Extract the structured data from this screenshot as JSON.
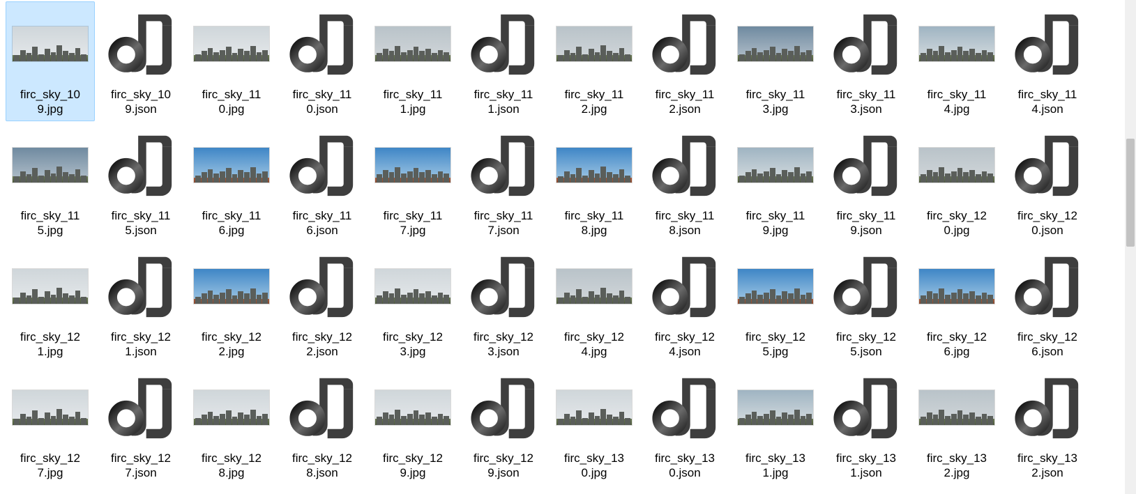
{
  "selected_index": 0,
  "files": [
    {
      "name_line1": "firc_sky_10",
      "name_line2": "9.jpg",
      "type": "jpg",
      "sky": "gray"
    },
    {
      "name_line1": "firc_sky_10",
      "name_line2": "9.json",
      "type": "json"
    },
    {
      "name_line1": "firc_sky_11",
      "name_line2": "0.jpg",
      "type": "jpg",
      "sky": "gray"
    },
    {
      "name_line1": "firc_sky_11",
      "name_line2": "0.json",
      "type": "json"
    },
    {
      "name_line1": "firc_sky_11",
      "name_line2": "1.jpg",
      "type": "jpg",
      "sky": "hazy"
    },
    {
      "name_line1": "firc_sky_11",
      "name_line2": "1.json",
      "type": "json"
    },
    {
      "name_line1": "firc_sky_11",
      "name_line2": "2.jpg",
      "type": "jpg",
      "sky": "hazy"
    },
    {
      "name_line1": "firc_sky_11",
      "name_line2": "2.json",
      "type": "json"
    },
    {
      "name_line1": "firc_sky_11",
      "name_line2": "3.jpg",
      "type": "jpg",
      "sky": "dusk"
    },
    {
      "name_line1": "firc_sky_11",
      "name_line2": "3.json",
      "type": "json"
    },
    {
      "name_line1": "firc_sky_11",
      "name_line2": "4.jpg",
      "type": "jpg",
      "sky": "cloud"
    },
    {
      "name_line1": "firc_sky_11",
      "name_line2": "4.json",
      "type": "json"
    },
    {
      "name_line1": "firc_sky_11",
      "name_line2": "5.jpg",
      "type": "jpg",
      "sky": "dusk"
    },
    {
      "name_line1": "firc_sky_11",
      "name_line2": "5.json",
      "type": "json"
    },
    {
      "name_line1": "firc_sky_11",
      "name_line2": "6.jpg",
      "type": "jpg",
      "sky": "blue"
    },
    {
      "name_line1": "firc_sky_11",
      "name_line2": "6.json",
      "type": "json"
    },
    {
      "name_line1": "firc_sky_11",
      "name_line2": "7.jpg",
      "type": "jpg",
      "sky": "blue"
    },
    {
      "name_line1": "firc_sky_11",
      "name_line2": "7.json",
      "type": "json"
    },
    {
      "name_line1": "firc_sky_11",
      "name_line2": "8.jpg",
      "type": "jpg",
      "sky": "blue"
    },
    {
      "name_line1": "firc_sky_11",
      "name_line2": "8.json",
      "type": "json"
    },
    {
      "name_line1": "firc_sky_11",
      "name_line2": "9.jpg",
      "type": "jpg",
      "sky": "cloud"
    },
    {
      "name_line1": "firc_sky_11",
      "name_line2": "9.json",
      "type": "json"
    },
    {
      "name_line1": "firc_sky_12",
      "name_line2": "0.jpg",
      "type": "jpg",
      "sky": "hazy"
    },
    {
      "name_line1": "firc_sky_12",
      "name_line2": "0.json",
      "type": "json"
    },
    {
      "name_line1": "firc_sky_12",
      "name_line2": "1.jpg",
      "type": "jpg",
      "sky": "gray"
    },
    {
      "name_line1": "firc_sky_12",
      "name_line2": "1.json",
      "type": "json"
    },
    {
      "name_line1": "firc_sky_12",
      "name_line2": "2.jpg",
      "type": "jpg",
      "sky": "blue"
    },
    {
      "name_line1": "firc_sky_12",
      "name_line2": "2.json",
      "type": "json"
    },
    {
      "name_line1": "firc_sky_12",
      "name_line2": "3.jpg",
      "type": "jpg",
      "sky": "gray"
    },
    {
      "name_line1": "firc_sky_12",
      "name_line2": "3.json",
      "type": "json"
    },
    {
      "name_line1": "firc_sky_12",
      "name_line2": "4.jpg",
      "type": "jpg",
      "sky": "hazy"
    },
    {
      "name_line1": "firc_sky_12",
      "name_line2": "4.json",
      "type": "json"
    },
    {
      "name_line1": "firc_sky_12",
      "name_line2": "5.jpg",
      "type": "jpg",
      "sky": "blue"
    },
    {
      "name_line1": "firc_sky_12",
      "name_line2": "5.json",
      "type": "json"
    },
    {
      "name_line1": "firc_sky_12",
      "name_line2": "6.jpg",
      "type": "jpg",
      "sky": "blue"
    },
    {
      "name_line1": "firc_sky_12",
      "name_line2": "6.json",
      "type": "json"
    },
    {
      "name_line1": "firc_sky_12",
      "name_line2": "7.jpg",
      "type": "jpg",
      "sky": "gray"
    },
    {
      "name_line1": "firc_sky_12",
      "name_line2": "7.json",
      "type": "json"
    },
    {
      "name_line1": "firc_sky_12",
      "name_line2": "8.jpg",
      "type": "jpg",
      "sky": "gray"
    },
    {
      "name_line1": "firc_sky_12",
      "name_line2": "8.json",
      "type": "json"
    },
    {
      "name_line1": "firc_sky_12",
      "name_line2": "9.jpg",
      "type": "jpg",
      "sky": "gray"
    },
    {
      "name_line1": "firc_sky_12",
      "name_line2": "9.json",
      "type": "json"
    },
    {
      "name_line1": "firc_sky_13",
      "name_line2": "0.jpg",
      "type": "jpg",
      "sky": "gray"
    },
    {
      "name_line1": "firc_sky_13",
      "name_line2": "0.json",
      "type": "json"
    },
    {
      "name_line1": "firc_sky_13",
      "name_line2": "1.jpg",
      "type": "jpg",
      "sky": "cloud"
    },
    {
      "name_line1": "firc_sky_13",
      "name_line2": "1.json",
      "type": "json"
    },
    {
      "name_line1": "firc_sky_13",
      "name_line2": "2.jpg",
      "type": "jpg",
      "sky": "hazy"
    },
    {
      "name_line1": "firc_sky_13",
      "name_line2": "2.json",
      "type": "json"
    }
  ]
}
